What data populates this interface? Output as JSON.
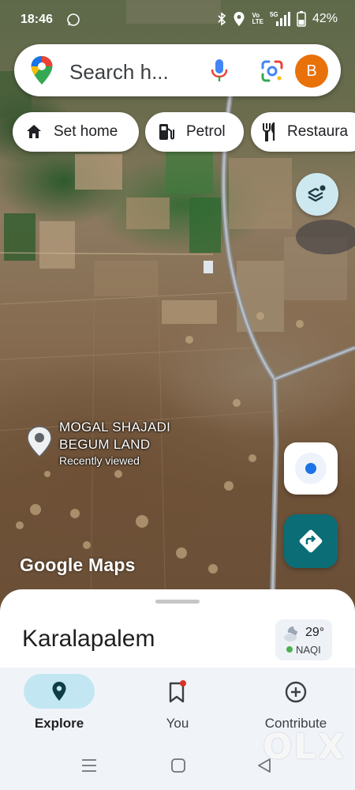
{
  "status_bar": {
    "time": "18:46",
    "volte_top": "Vo",
    "volte_bottom": "LTE",
    "network": "5G",
    "battery": "42%"
  },
  "search": {
    "placeholder": "Search h...",
    "avatar_letter": "B"
  },
  "chips": [
    {
      "label": "Set home",
      "icon": "home-icon"
    },
    {
      "label": "Petrol",
      "icon": "fuel-pump-icon"
    },
    {
      "label": "Restaura",
      "icon": "restaurant-icon"
    }
  ],
  "map": {
    "place_name": "MOGAL SHAJADI BEGUM LAND",
    "place_subtitle": "Recently viewed",
    "watermark": "Google Maps"
  },
  "sheet": {
    "title": "Karalapalem",
    "temperature": "29°",
    "aqi_label": "NAQI",
    "aqi_color": "#4caf50"
  },
  "nav": [
    {
      "label": "Explore",
      "icon": "explore-pin-icon",
      "active": true
    },
    {
      "label": "You",
      "icon": "bookmark-icon",
      "active": false
    },
    {
      "label": "Contribute",
      "icon": "add-circle-icon",
      "active": false
    }
  ],
  "watermark_brand": "OLX",
  "colors": {
    "accent_teal": "#0b6e77",
    "location_blue": "#1a73e8",
    "avatar_orange": "#e8710a",
    "nav_pill": "#c2e7f2"
  }
}
